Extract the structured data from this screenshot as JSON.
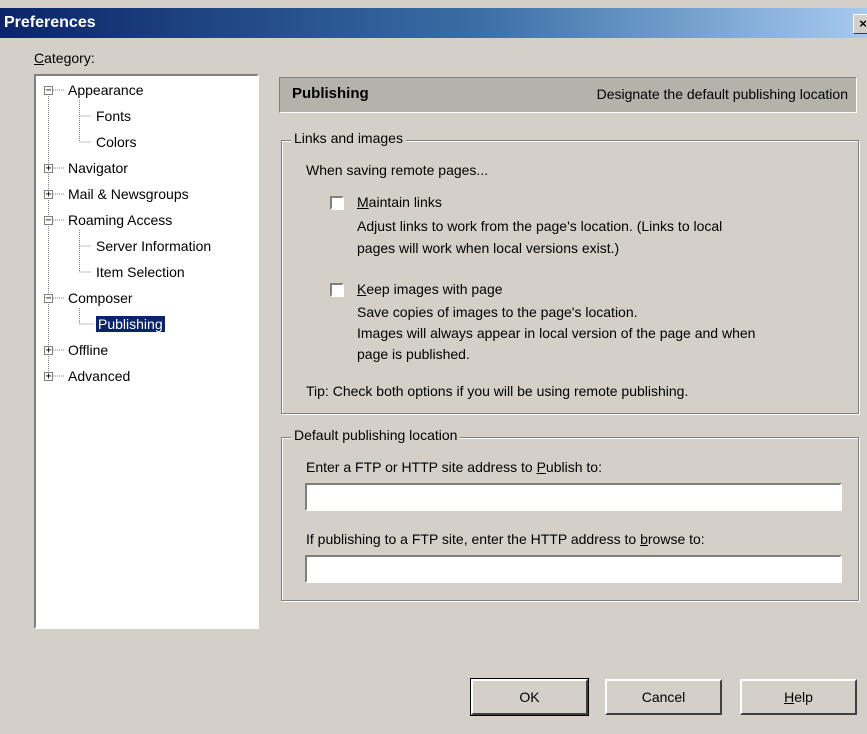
{
  "window": {
    "title": "Preferences",
    "close_glyph": "×"
  },
  "category": {
    "label_first": "C",
    "label_rest": "ategory:"
  },
  "tree": {
    "items": [
      {
        "label": "Appearance",
        "expander": "−"
      },
      {
        "label": "Fonts"
      },
      {
        "label": "Colors"
      },
      {
        "label": "Navigator",
        "expander": "+"
      },
      {
        "label": "Mail & Newsgroups",
        "expander": "+"
      },
      {
        "label": "Roaming Access",
        "expander": "−"
      },
      {
        "label": "Server Information"
      },
      {
        "label": "Item Selection"
      },
      {
        "label": "Composer",
        "expander": "−"
      },
      {
        "label": "Publishing",
        "selected": true
      },
      {
        "label": "Offline",
        "expander": "+"
      },
      {
        "label": "Advanced",
        "expander": "+"
      }
    ]
  },
  "header": {
    "title": "Publishing",
    "description": "Designate the default publishing location"
  },
  "links_group": {
    "legend": "Links and images",
    "intro": "When saving remote pages...",
    "maintain": {
      "mnemonic": "M",
      "rest": "aintain links",
      "desc1": "Adjust links to work from the page's location. (Links to local",
      "desc2": "pages will work when local versions exist.)"
    },
    "keep": {
      "mnemonic": "K",
      "rest": "eep images with page",
      "desc1": "Save copies of images to the page's location.",
      "desc2": "Images will always appear in local version of the page and when",
      "desc3": "page is published."
    },
    "tip": "Tip: Check both options if you will be using remote publishing."
  },
  "location_group": {
    "legend": "Default publishing location",
    "publish_pre": "Enter a FTP or HTTP site address to ",
    "publish_mn": "P",
    "publish_post": "ublish to:",
    "publish_value": "",
    "browse_pre": "If publishing to a FTP site, enter the HTTP address to ",
    "browse_mn": "b",
    "browse_post": "rowse to:",
    "browse_value": ""
  },
  "buttons": {
    "ok": "OK",
    "cancel": "Cancel",
    "help_mn": "H",
    "help_rest": "elp"
  },
  "colors": {
    "title_start": "#0a246a",
    "title_end": "#a6caf0",
    "selection": "#0a246a",
    "face": "#d4d0c8"
  }
}
